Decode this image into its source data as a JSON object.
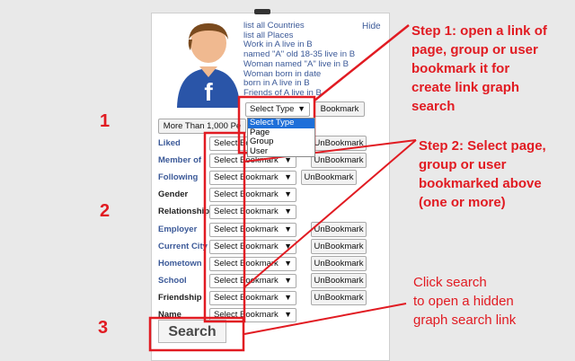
{
  "menu": {
    "links": [
      "list all Countries",
      "list all Places",
      "Work in A live in B",
      "named \"A\" old 18-35 live in B",
      "Woman named \"A\" live in B",
      "Woman born in date",
      "born in A live in B",
      "Friends of A live in B"
    ],
    "hide": "Hide"
  },
  "type_select": {
    "value": "Select Type",
    "bookmark_btn": "Bookmark",
    "options": [
      "Select Type",
      "Page",
      "Group",
      "User"
    ]
  },
  "more_than": "More Than 1,000 Pe",
  "filters": [
    {
      "label": "Liked",
      "select": "Select Bookmark",
      "btn": "UnBookmark"
    },
    {
      "label": "Member of",
      "select": "Select Bookmark",
      "btn": "UnBookmark"
    },
    {
      "label": "Following",
      "select": "Select Bookmark",
      "btn": "UnBookmark"
    },
    {
      "label": "Gender",
      "select": "Select Bookmark",
      "btn": ""
    },
    {
      "label": "Relationship",
      "select": "Select Bookmark",
      "btn": ""
    },
    {
      "label": "Employer",
      "select": "Select Bookmark",
      "btn": "UnBookmark"
    },
    {
      "label": "Current City",
      "select": "Select Bookmark",
      "btn": "UnBookmark"
    },
    {
      "label": "Hometown",
      "select": "Select Bookmark",
      "btn": "UnBookmark"
    },
    {
      "label": "School",
      "select": "Select Bookmark",
      "btn": "UnBookmark"
    },
    {
      "label": "Friendship",
      "select": "Select Bookmark",
      "btn": "UnBookmark"
    },
    {
      "label": "Name",
      "select": "Select Bookmark",
      "btn": ""
    }
  ],
  "search": "Search",
  "steps": {
    "n1": "1",
    "n2": "2",
    "n3": "3",
    "step1": [
      "Step 1: open a link  of",
      "page, group or user",
      "bookmark it for",
      "create link graph",
      "search"
    ],
    "step2": [
      "Step 2: Select page,",
      "group or user",
      "bookmarked above",
      "(one or more)"
    ],
    "step3": [
      "Click search",
      "to open a hidden",
      "graph search link"
    ]
  },
  "colors": {
    "accent": "#e11b22",
    "link": "#3b5998"
  }
}
